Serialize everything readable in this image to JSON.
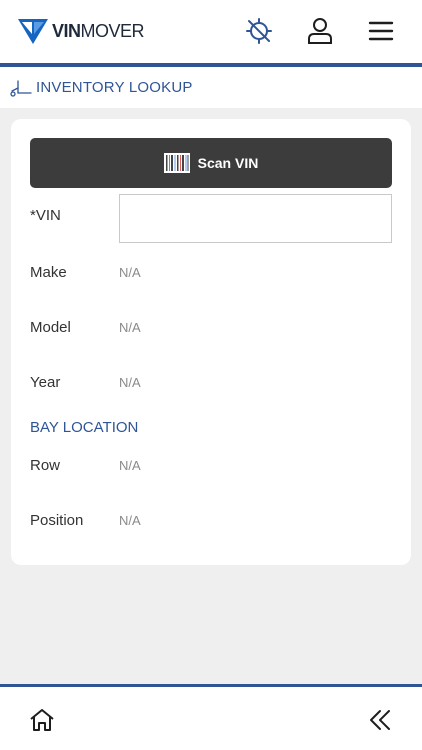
{
  "header": {
    "logo_bold": "VIN",
    "logo_regular": "MOVER",
    "icons": [
      "gps-off-icon",
      "user-icon",
      "menu-icon"
    ]
  },
  "section": {
    "title": "INVENTORY LOOKUP",
    "icon": "forklift-icon"
  },
  "form": {
    "scan_label": "Scan VIN",
    "scan_icon": "barcode-icon",
    "vin_label": "*VIN",
    "vin_value": "",
    "fields": [
      {
        "label": "Make",
        "value": "N/A"
      },
      {
        "label": "Model",
        "value": "N/A"
      },
      {
        "label": "Year",
        "value": "N/A"
      }
    ],
    "bay_title": "BAY LOCATION",
    "bay_fields": [
      {
        "label": "Row",
        "value": "N/A"
      },
      {
        "label": "Position",
        "value": "N/A"
      }
    ]
  },
  "footer": {
    "icons": [
      "home-icon",
      "double-chevron-left-icon"
    ]
  },
  "colors": {
    "accent": "#2f5597",
    "button": "#3c3c3c",
    "logo_blue": "#1565c0"
  }
}
